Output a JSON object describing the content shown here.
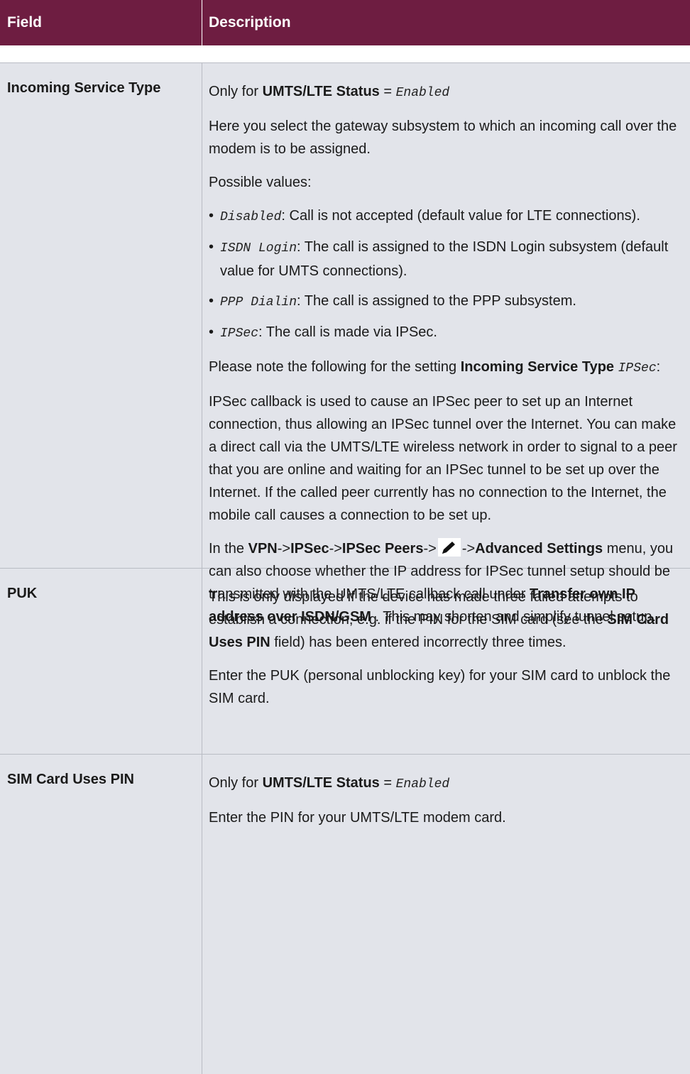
{
  "header": {
    "field": "Field",
    "description": "Description"
  },
  "rows": [
    {
      "field": "Incoming Service Type",
      "only_for_prefix": "Only for",
      "only_for_bold": "UMTS/LTE Status",
      "only_for_eq": "=",
      "only_for_value": "Enabled",
      "p1": "Here you select the gateway subsystem to which an incoming call over the modem is to be assigned.",
      "p2": "Possible values:",
      "bullets": [
        {
          "value": "Disabled",
          "text": ": Call is not accepted (default value for LTE connections)."
        },
        {
          "value": "ISDN Login",
          "text": ": The call is assigned to the ISDN Login subsystem (default value for UMTS connections)."
        },
        {
          "value": "PPP Dialin",
          "text": ": The call is assigned to the PPP subsystem."
        },
        {
          "value": "IPSec",
          "text": ": The call is made via IPSec."
        }
      ],
      "note_prefix": "Please note the following for the setting",
      "note_bold": "Incoming Service Type",
      "note_value": "IPSec",
      "note_suffix": ":",
      "p3": "IPSec callback is used to cause an IPSec peer to set up an Internet connection, thus allowing an IPSec tunnel over the Internet. You can make a direct call via the UMTS/LTE wireless network in order to signal to a peer that you are online and waiting for an IPSec tunnel to be set up over the Internet. If the called peer currently has no connection to the Internet, the mobile call causes a connection to be set up.",
      "menu_prefix": "In the",
      "menu_vpn": "VPN",
      "menu_arrow": "->",
      "menu_ipsec": "IPSec",
      "menu_peers": "IPSec Peers",
      "menu_adv": "Advanced Settings",
      "menu_text1": "menu, you can also choose whether the IP address for IPSec tunnel setup should be transmitted with the UMTS/LTE callback call under",
      "menu_bold2": "Transfer own IP address over ISDN/GSM",
      "menu_text2": ". This may shorten and simplify tunnel setup.",
      "edit_icon": "pencil-icon"
    },
    {
      "field": "PUK",
      "p1_pre": "This is only displayed if the device has made three failed attempts to establish a connection, e.g. if the PIN for the SIM card (see the",
      "p1_bold": "SIM Card Uses PIN",
      "p1_post": "field) has been entered incorrectly three times.",
      "p2": "Enter the PUK (personal unblocking key) for your SIM card to unblock the SIM card."
    },
    {
      "field": "SIM Card Uses PIN",
      "only_for_prefix": "Only for",
      "only_for_bold": "UMTS/LTE Status",
      "only_for_eq": "=",
      "only_for_value": "Enabled",
      "p1": "Enter the PIN for your UMTS/LTE modem card."
    }
  ]
}
